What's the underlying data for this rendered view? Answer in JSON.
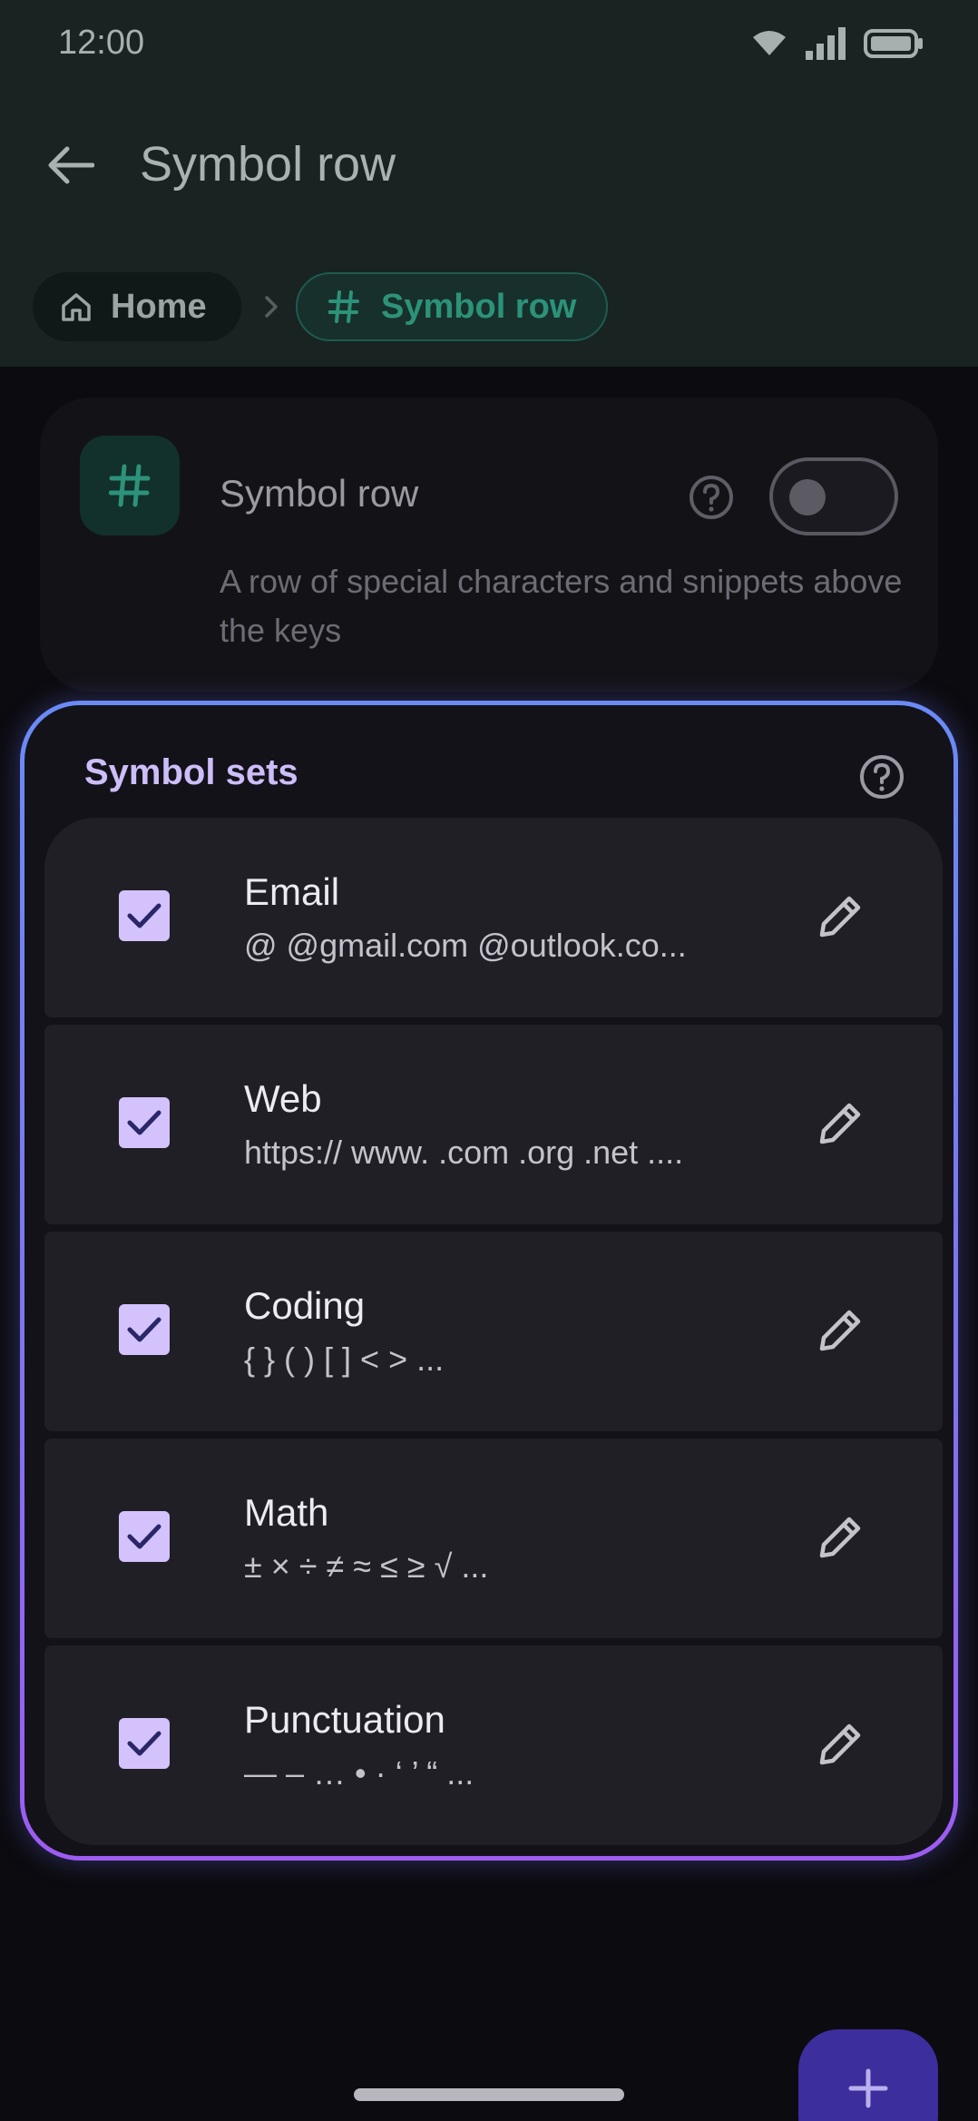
{
  "status_bar": {
    "time": "12:00"
  },
  "app_bar": {
    "title": "Symbol row"
  },
  "breadcrumb": {
    "home": "Home",
    "current": "Symbol row"
  },
  "toggle_card": {
    "title": "Symbol row",
    "description": "A row of special characters and snippets above the keys",
    "enabled": false
  },
  "symbol_sets": {
    "title": "Symbol sets",
    "items": [
      {
        "name": "Email",
        "preview": "@ @gmail.com @outlook.co...",
        "checked": true
      },
      {
        "name": "Web",
        "preview": "https:// www. .com .org .net ....",
        "checked": true
      },
      {
        "name": "Coding",
        "preview": "{ } ( ) [ ] < > ...",
        "checked": true
      },
      {
        "name": "Math",
        "preview": "± × ÷ ≠ ≈ ≤ ≥ √ ...",
        "checked": true
      },
      {
        "name": "Punctuation",
        "preview": "— – … • · ‘ ’ “ ...",
        "checked": true
      }
    ]
  },
  "colors": {
    "accent_teal": "#2c9279",
    "checkbox": "#d3c2fc",
    "frame_gradient_start": "#6a8bf6",
    "frame_gradient_end": "#9d5cf2",
    "fab": "#3c2e9c"
  },
  "icons": [
    "wifi-icon",
    "signal-icon",
    "battery-icon",
    "back-arrow-icon",
    "home-icon",
    "chevron-right-icon",
    "hash-icon",
    "help-icon",
    "check-icon",
    "pencil-icon",
    "plus-icon"
  ]
}
